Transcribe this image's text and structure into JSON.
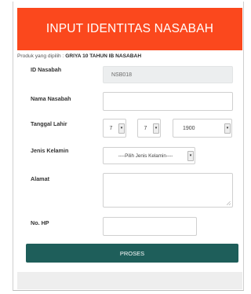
{
  "header": {
    "title": "INPUT IDENTITAS NASABAH"
  },
  "produk": {
    "label": "Produk yang dipilih :",
    "value": "GRIYA 10 TAHUN IB NASABAH"
  },
  "form": {
    "id_nasabah": {
      "label": "ID Nasabah",
      "value": "NSB018"
    },
    "nama_nasabah": {
      "label": "Nama Nasabah",
      "value": ""
    },
    "tanggal_lahir": {
      "label": "Tanggal Lahir",
      "day": "7",
      "month": "7",
      "year": "1900"
    },
    "jenis_kelamin": {
      "label": "Jenis Kelamin",
      "selected": "----Pilih Jenis Kelamin----"
    },
    "alamat": {
      "label": "Alamat",
      "value": ""
    },
    "no_hp": {
      "label": "No. HP",
      "value": ""
    },
    "submit_label": "PROSES"
  },
  "colors": {
    "header_bg": "#fb481d",
    "button_bg": "#1e5e5a",
    "readonly_bg": "#eceeef"
  },
  "icons": {
    "select_caret": "caret-down-icon",
    "resize": "resize-grip-icon"
  }
}
